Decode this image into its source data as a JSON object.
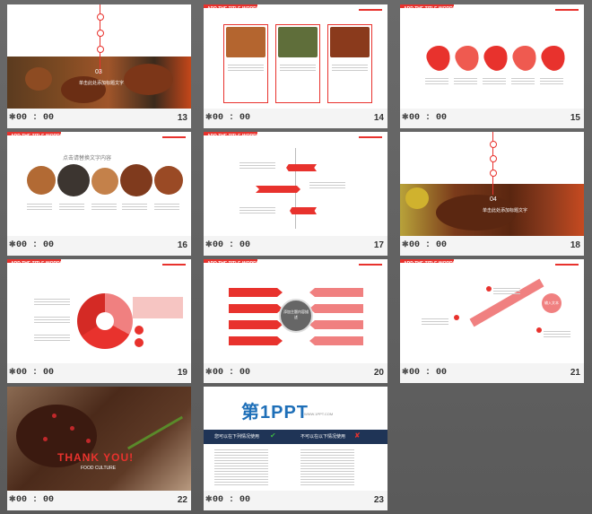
{
  "slides": [
    {
      "num": "13",
      "time": "00 : 00",
      "overlay_num": "03",
      "overlay_text": "单击此处添加标题文字"
    },
    {
      "num": "14",
      "time": "00 : 00",
      "header": "ADD THE TITLE WORDS"
    },
    {
      "num": "15",
      "time": "00 : 00",
      "header": "ADD THE TITLE WORDS"
    },
    {
      "num": "16",
      "time": "00 : 00",
      "header": "ADD THE TITLE WORDS",
      "subtitle": "点击请替换文字内容"
    },
    {
      "num": "17",
      "time": "00 : 00",
      "header": "ADD THE TITLE WORDS"
    },
    {
      "num": "18",
      "time": "00 : 00",
      "overlay_num": "04",
      "overlay_text": "单击此处添加标题文字"
    },
    {
      "num": "19",
      "time": "00 : 00",
      "header": "ADD THE TITLE WORDS"
    },
    {
      "num": "20",
      "time": "00 : 00",
      "header": "ADD THE TITLE WORDS",
      "center_text": "添加主题内容描述"
    },
    {
      "num": "21",
      "time": "00 : 00",
      "header": "ADD THE TITLE WORDS",
      "target_text": "输入文本"
    },
    {
      "num": "22",
      "time": "00 : 00",
      "thank": "THANK YOU!",
      "thank_sub": "FOOD CULTURE"
    },
    {
      "num": "23",
      "time": "00 : 00",
      "brand": "第1PPT",
      "url": "WWW.1PPT.COM",
      "col1": "您可以在下列情况使用",
      "col2": "不可以在以下情况使用"
    }
  ],
  "colors": {
    "accent": "#e8322d",
    "background": "#606060",
    "footer": "#f4f4f4"
  }
}
